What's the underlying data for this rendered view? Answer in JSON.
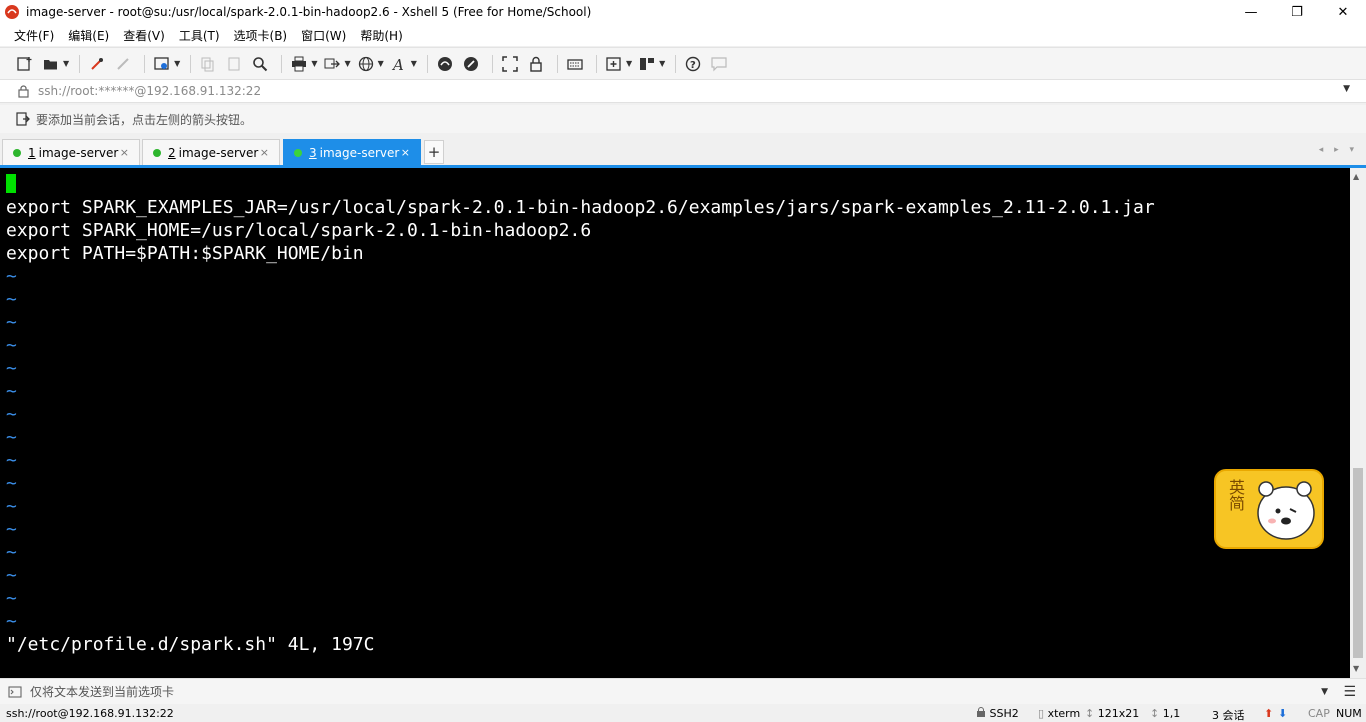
{
  "window": {
    "title": "image-server - root@su:/usr/local/spark-2.0.1-bin-hadoop2.6 - Xshell 5 (Free for Home/School)",
    "minimize": "—",
    "maximize": "❐",
    "close": "✕"
  },
  "menu": {
    "items": [
      "文件(F)",
      "编辑(E)",
      "查看(V)",
      "工具(T)",
      "选项卡(B)",
      "窗口(W)",
      "帮助(H)"
    ]
  },
  "address": {
    "text": "ssh://root:******@192.168.91.132:22"
  },
  "hint": {
    "text": "要添加当前会话，点击左侧的箭头按钮。"
  },
  "tabs": [
    {
      "num": "1",
      "label": "image-server",
      "close": "×"
    },
    {
      "num": "2",
      "label": "image-server",
      "close": "×"
    },
    {
      "num": "3",
      "label": "image-server",
      "close": "×"
    }
  ],
  "tab_add": "+",
  "tab_nav": "◂ ▸ ▾",
  "terminal": {
    "lines": [
      "export SPARK_EXAMPLES_JAR=/usr/local/spark-2.0.1-bin-hadoop2.6/examples/jars/spark-examples_2.11-2.0.1.jar",
      "export SPARK_HOME=/usr/local/spark-2.0.1-bin-hadoop2.6",
      "export PATH=$PATH:$SPARK_HOME/bin"
    ],
    "tilde": "~",
    "status_line": "\"/etc/profile.d/spark.sh\" 4L, 197C"
  },
  "send": {
    "text": "仅将文本发送到当前选项卡"
  },
  "status": {
    "connection": "ssh://root@192.168.91.132:22",
    "protocol": "SSH2",
    "term": "xterm",
    "size": "121x21",
    "position": "1,1",
    "sessions": "3 会话",
    "cap": "CAP",
    "num": "NUM"
  },
  "ime": {
    "text": "英简"
  },
  "colors": {
    "accent": "#1e8ee8",
    "terminal_bg": "#000000",
    "cursor": "#00e000",
    "tilde": "#3a8ee8"
  }
}
